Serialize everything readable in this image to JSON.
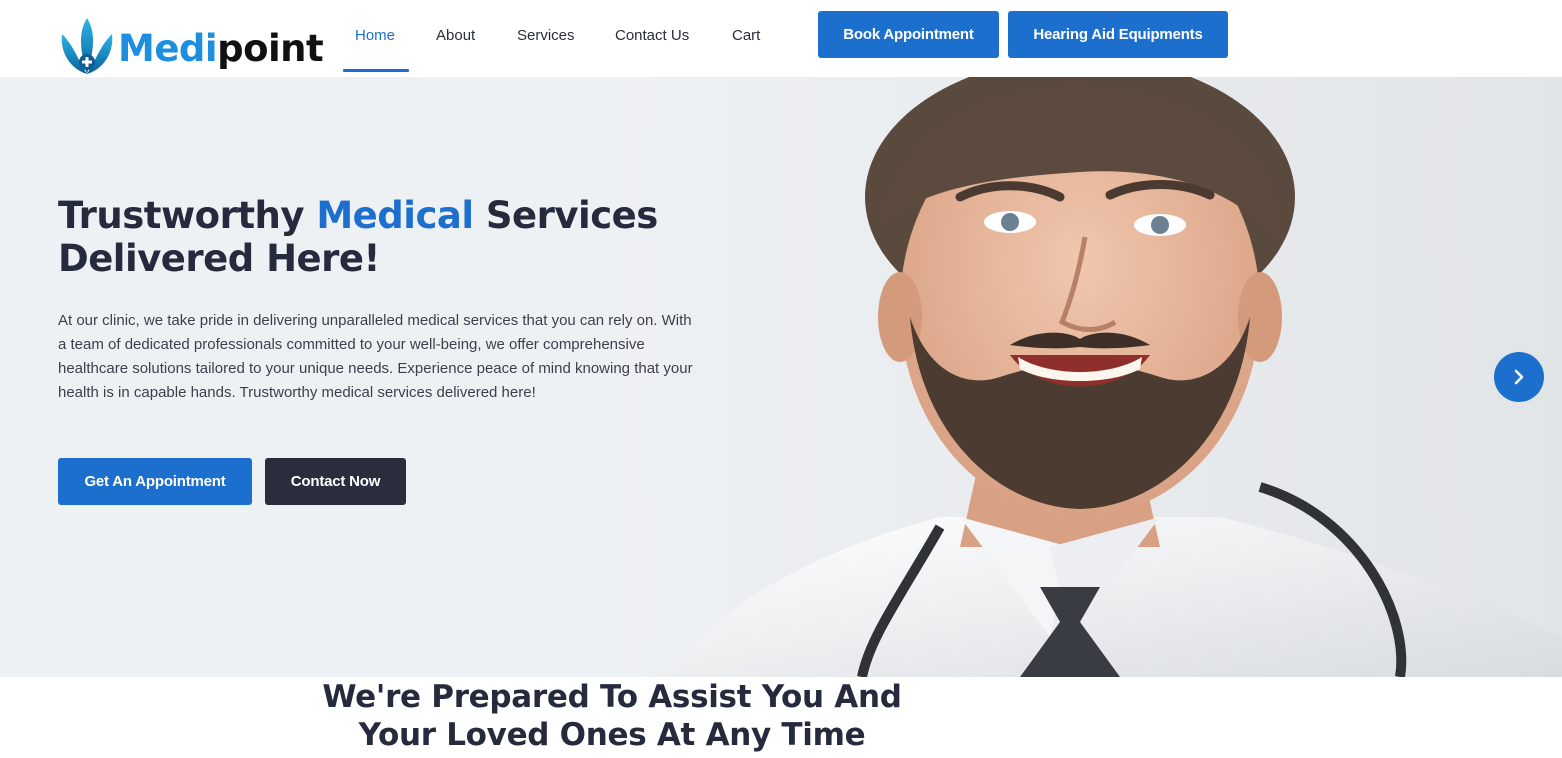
{
  "brand": {
    "name_part1": "Medi",
    "name_part2": "point",
    "logo_icon": "lotus-cross-icon"
  },
  "nav": {
    "items": [
      {
        "label": "Home",
        "active": true
      },
      {
        "label": "About",
        "active": false
      },
      {
        "label": "Services",
        "active": false
      },
      {
        "label": "Contact Us",
        "active": false
      },
      {
        "label": "Cart",
        "active": false
      }
    ]
  },
  "header_buttons": {
    "book": "Book Appointment",
    "hearing": "Hearing Aid Equipments"
  },
  "hero": {
    "title_part1": "Trustworthy ",
    "title_accent": "Medical",
    "title_part2": " Services Delivered Here!",
    "description": "At our clinic, we take pride in delivering unparalleled medical services that you can rely on. With a team of dedicated professionals committed to your well-being, we offer comprehensive healthcare solutions tailored to your unique needs. Experience peace of mind knowing that your health is in capable hands. Trustworthy medical services delivered here!",
    "primary_button": "Get An Appointment",
    "secondary_button": "Contact Now",
    "next_icon": "chevron-right-icon"
  },
  "section": {
    "heading_line1": "We're Prepared To Assist You And",
    "heading_line2": "Your Loved Ones At Any Time"
  },
  "colors": {
    "accent": "#1d6fce",
    "dark": "#2a2d3e",
    "heading": "#262a3d",
    "hero_bg": "#eef1f4"
  }
}
